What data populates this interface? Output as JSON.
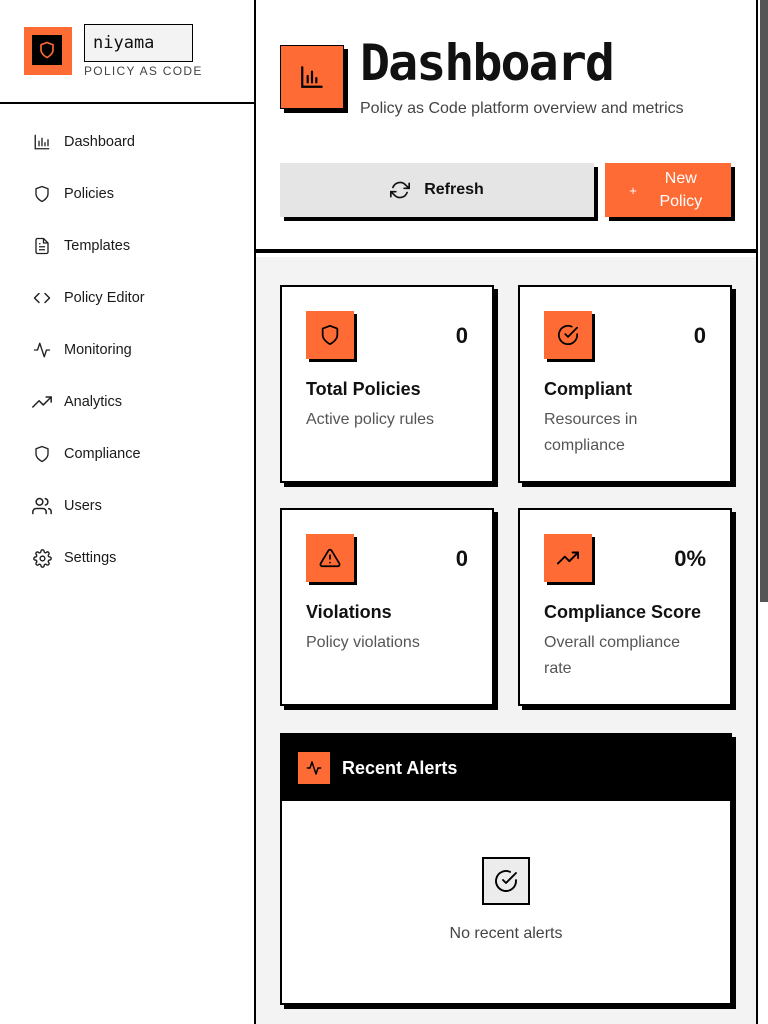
{
  "brand": {
    "name": "niyama",
    "tagline": "POLICY AS CODE"
  },
  "sidebar": {
    "items": [
      {
        "label": "Dashboard",
        "icon": "bar-chart-icon"
      },
      {
        "label": "Policies",
        "icon": "shield-icon"
      },
      {
        "label": "Templates",
        "icon": "file-text-icon"
      },
      {
        "label": "Policy Editor",
        "icon": "code-icon"
      },
      {
        "label": "Monitoring",
        "icon": "activity-icon"
      },
      {
        "label": "Analytics",
        "icon": "trending-up-icon"
      },
      {
        "label": "Compliance",
        "icon": "shield-icon"
      },
      {
        "label": "Users",
        "icon": "users-icon"
      },
      {
        "label": "Settings",
        "icon": "gear-icon"
      }
    ]
  },
  "header": {
    "title": "Dashboard",
    "subtitle": "Policy as Code platform overview and metrics",
    "refresh_label": "Refresh",
    "new_policy_label": "New Policy",
    "new_policy_plus": "+"
  },
  "stats": [
    {
      "value": "0",
      "title": "Total Policies",
      "description": "Active policy rules",
      "icon": "shield-icon"
    },
    {
      "value": "0",
      "title": "Compliant",
      "description": "Resources in compliance",
      "icon": "check-circle-icon"
    },
    {
      "value": "0",
      "title": "Violations",
      "description": "Policy violations",
      "icon": "alert-triangle-icon"
    },
    {
      "value": "0%",
      "title": "Compliance Score",
      "description": "Overall compliance rate",
      "icon": "trending-up-icon"
    }
  ],
  "alerts": {
    "title": "Recent Alerts",
    "empty_text": "No recent alerts"
  },
  "colors": {
    "accent": "#ff6b35",
    "border": "#000000",
    "background": "#f3f3f3"
  }
}
